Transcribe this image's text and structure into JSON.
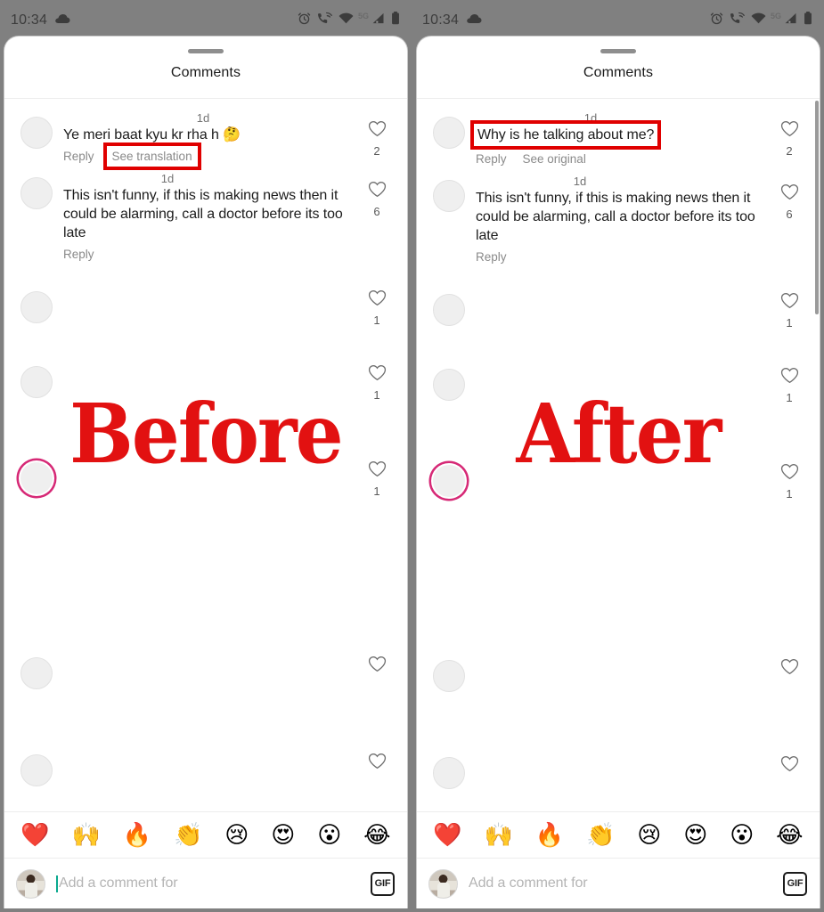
{
  "meta": {
    "label_before": "Before",
    "label_after": "After",
    "annotation_color": "#e00000"
  },
  "statusbar": {
    "time": "10:34",
    "left_icons": [
      "cloud-icon"
    ],
    "right_icons": [
      "alarm-icon",
      "vowifi-call-icon",
      "wifi-icon",
      "signal-icon",
      "battery-icon"
    ],
    "network_label": "5G"
  },
  "sheet": {
    "title": "Comments",
    "grabber": "sheet-grabber"
  },
  "composer": {
    "placeholder": "Add a comment for",
    "gif_label": "GIF"
  },
  "emoji_bar": [
    {
      "name": "red-heart-emoji",
      "glyph": "❤️"
    },
    {
      "name": "raising-hands-emoji",
      "glyph": "🙌"
    },
    {
      "name": "fire-emoji",
      "glyph": "🔥"
    },
    {
      "name": "clapping-hands-emoji",
      "glyph": "👏"
    },
    {
      "name": "crying-face-emoji",
      "glyph": "😢"
    },
    {
      "name": "heart-eyes-emoji",
      "glyph": "😍"
    },
    {
      "name": "surprised-face-emoji",
      "glyph": "😮"
    },
    {
      "name": "joy-face-emoji",
      "glyph": "😂"
    }
  ],
  "labels": {
    "reply": "Reply",
    "see_translation": "See translation",
    "see_original": "See original",
    "time_1d": "1d"
  },
  "before_panel": {
    "comments": [
      {
        "time": "1d",
        "text": "Ye meri baat kyu kr rha h 🤔",
        "actions": [
          "Reply",
          "See translation"
        ],
        "highlight_action": "See translation",
        "likes": "2",
        "avatar": "placeholder"
      },
      {
        "time": "1d",
        "text": "This isn't funny, if this is making news then it could be alarming, call a doctor before its too late",
        "actions": [
          "Reply"
        ],
        "likes": "6",
        "avatar": "placeholder"
      },
      {
        "time": "",
        "text": "",
        "actions": [],
        "likes": "1",
        "avatar": "placeholder"
      },
      {
        "time": "",
        "text": "",
        "actions": [],
        "likes": "1",
        "avatar": "placeholder"
      },
      {
        "time": "",
        "text": "",
        "actions": [],
        "likes": "1",
        "avatar": "story-ring"
      },
      {
        "time": "",
        "text": "",
        "actions": [],
        "likes": "",
        "avatar": "placeholder"
      },
      {
        "time": "",
        "text": "",
        "actions": [],
        "likes": "",
        "avatar": "placeholder"
      }
    ]
  },
  "after_panel": {
    "comments": [
      {
        "time": "1d",
        "text": "Why is he talking about me?",
        "actions": [
          "Reply",
          "See original"
        ],
        "highlight_text": true,
        "likes": "2",
        "avatar": "placeholder"
      },
      {
        "time": "1d",
        "text": "This isn't funny, if this is making news then it could be alarming, call a doctor before its too late",
        "actions": [
          "Reply"
        ],
        "likes": "6",
        "avatar": "placeholder"
      },
      {
        "time": "",
        "text": "",
        "actions": [],
        "likes": "1",
        "avatar": "placeholder"
      },
      {
        "time": "",
        "text": "",
        "actions": [],
        "likes": "1",
        "avatar": "placeholder"
      },
      {
        "time": "",
        "text": "",
        "actions": [],
        "likes": "1",
        "avatar": "story-ring"
      },
      {
        "time": "",
        "text": "",
        "actions": [],
        "likes": "",
        "avatar": "placeholder"
      },
      {
        "time": "",
        "text": "",
        "actions": [],
        "likes": "",
        "avatar": "placeholder"
      }
    ]
  }
}
